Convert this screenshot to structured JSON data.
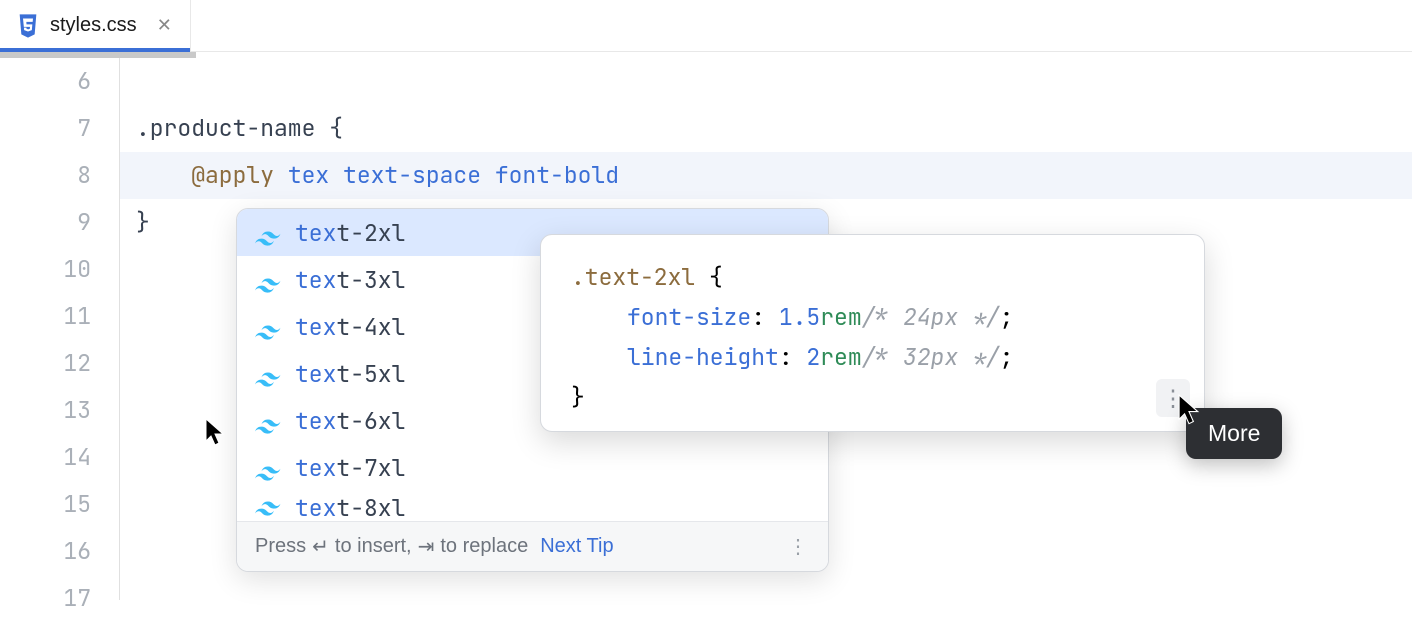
{
  "tab": {
    "filename": "styles.css"
  },
  "gutter": {
    "start": 6,
    "end": 17
  },
  "code": {
    "line7": {
      "selector": ".product-name",
      "open": " {"
    },
    "line8": {
      "indent": "    ",
      "at": "@apply",
      "space": " ",
      "rest": "tex text-space font-bold"
    },
    "line9": {
      "close": "}"
    }
  },
  "autocomplete": {
    "match_prefix": "tex",
    "items": [
      {
        "rest": "t-2xl",
        "selected": true
      },
      {
        "rest": "t-3xl",
        "selected": false
      },
      {
        "rest": "t-4xl",
        "selected": false
      },
      {
        "rest": "t-5xl",
        "selected": false
      },
      {
        "rest": "t-6xl",
        "selected": false
      },
      {
        "rest": "t-7xl",
        "selected": false
      }
    ],
    "partial_item": {
      "rest": "t-8xl"
    },
    "footer": {
      "press": "Press ",
      "enter": "↵",
      "to_insert": " to insert, ",
      "tab": "⇥",
      "to_replace": " to replace",
      "next_tip": "Next Tip"
    }
  },
  "doc": {
    "selector": ".text-2xl",
    "open": " {",
    "prop1": {
      "name": "font-size",
      "colon": ": ",
      "num": "1.5",
      "unit": "rem",
      "comment": "/* 24px */",
      "semi": ";"
    },
    "prop2": {
      "name": "line-height",
      "colon": ": ",
      "num": "2",
      "unit": "rem",
      "comment": "/* 32px */",
      "semi": ";"
    },
    "close": "}"
  },
  "tooltip": {
    "label": "More"
  }
}
